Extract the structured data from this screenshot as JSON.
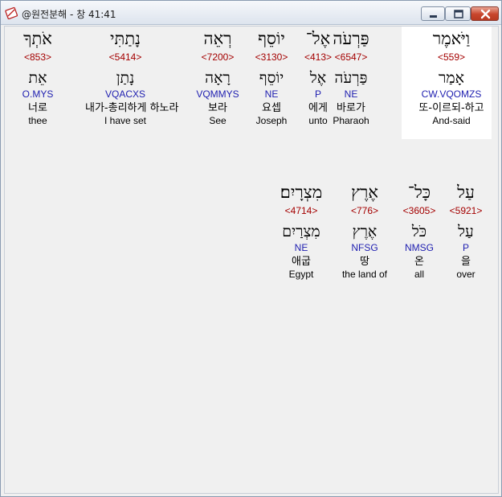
{
  "window": {
    "title": "@원전분해 - 창 41:41",
    "accent": "#c8452c"
  },
  "lines": [
    {
      "words": [
        {
          "surface": "וַיֹּאמֶר",
          "strong": "<559>",
          "root": "אָמַר",
          "parse": "CW.VQOMZS",
          "korean": "또-이르되-하고",
          "english": "And-said"
        },
        {
          "surface": "פַּרְעֹה",
          "strong": "<6547>",
          "root": "פַּרְעֹה",
          "parse": "NE",
          "korean": "바로가",
          "english": "Pharaoh"
        },
        {
          "surface": "אֶל־",
          "strong": "<413>",
          "root": "אֶל",
          "parse": "P",
          "korean": "에게",
          "english": "unto"
        },
        {
          "surface": "יוֹסֵף",
          "strong": "<3130>",
          "root": "יוֹסֵף",
          "parse": "NE",
          "korean": "요셉",
          "english": "Joseph"
        },
        {
          "surface": "רְאֵה",
          "strong": "<7200>",
          "root": "רָאָה",
          "parse": "VQMMYS",
          "korean": "보라",
          "english": "See"
        },
        {
          "surface": "נָתַתִּי",
          "strong": "<5414>",
          "root": "נָתַן",
          "parse": "VQACXS",
          "korean": "내가-총리하게 하노라",
          "english": "I have set"
        },
        {
          "surface": "אֹתְךָ",
          "strong": "<853>",
          "root": "אֵת",
          "parse": "O.MYS",
          "korean": "너로",
          "english": "thee"
        }
      ]
    },
    {
      "words": [
        {
          "surface": "עַל",
          "strong": "<5921>",
          "root": "עַל",
          "parse": "P",
          "korean": "을",
          "english": "over"
        },
        {
          "surface": "כָּל־",
          "strong": "<3605>",
          "root": "כֹּל",
          "parse": "NMSG",
          "korean": "온",
          "english": "all"
        },
        {
          "surface": "אֶרֶץ",
          "strong": "<776>",
          "root": "אֶרֶץ",
          "parse": "NFSG",
          "korean": "땅",
          "english": "the land of"
        },
        {
          "surface": "מִצְרָיִם׃",
          "strong": "<4714>",
          "root": "מִצְרַיִם",
          "parse": "NE",
          "korean": "애굽",
          "english": "Egypt"
        }
      ]
    }
  ]
}
